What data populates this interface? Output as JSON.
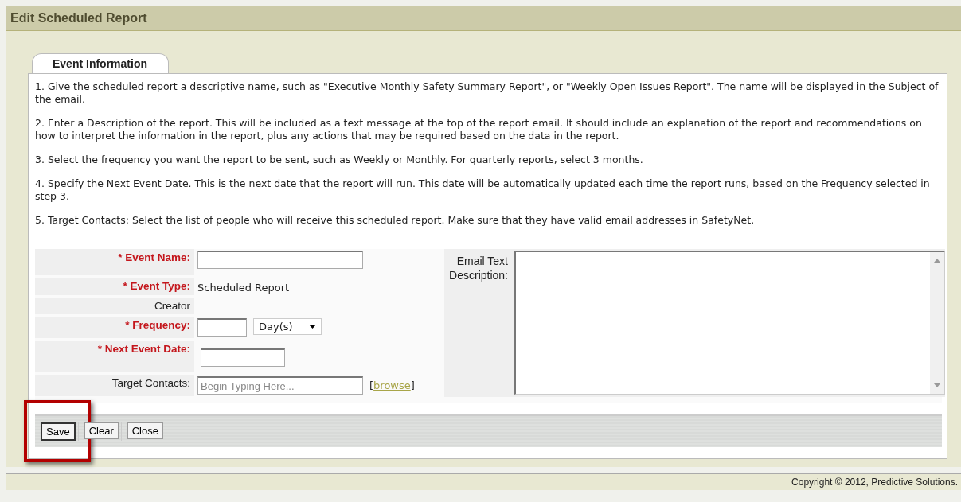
{
  "window": {
    "title": "Edit Scheduled Report"
  },
  "tabs": [
    {
      "label": "Event Information",
      "selected": true
    }
  ],
  "instructions": [
    "1. Give the scheduled report a descriptive name, such as \"Executive Monthly Safety Summary Report\", or \"Weekly Open Issues Report\". The name will be displayed in the Subject of the email.",
    "2. Enter a Description of the report. This will be included as a text message at the top of the report email. It should include an explanation of the report and recommendations on how to interpret the information in the report, plus any actions that may be required based on the data in the report.",
    "3. Select the frequency you want the report to be sent, such as Weekly or Monthly. For quarterly reports, select 3 months.",
    "4. Specify the Next Event Date. This is the next date that the report will run. This date will be automatically updated each time the report runs, based on the Frequency selected in step 3.",
    "5. Target Contacts: Select the list of people who will receive this scheduled report. Make sure that they have valid email addresses in SafetyNet."
  ],
  "fields": [
    {
      "kind": "text",
      "label": "* Event Name:",
      "required": true
    },
    {
      "kind": "static",
      "label": "* Event Type:",
      "required": true,
      "value": "Scheduled Report"
    },
    {
      "kind": "static",
      "label": "Creator",
      "required": false
    },
    {
      "kind": "frequency",
      "label": "* Frequency:",
      "required": true,
      "unit": "Day(s)"
    },
    {
      "kind": "date",
      "label": "* Next Event Date:",
      "required": true
    },
    {
      "kind": "contacts",
      "label": "Target Contacts:",
      "required": false,
      "placeholder": "Begin Typing Here...",
      "link_open": "[",
      "link": "browse",
      "link_close": "]"
    }
  ],
  "description": {
    "label": "Email Text Description:"
  },
  "buttons": [
    {
      "label": "Save",
      "highlighted": true
    },
    {
      "label": "Clear",
      "highlighted": false
    },
    {
      "label": "Close",
      "highlighted": false
    }
  ],
  "footer": "Copyright © 2012, Predictive Solutions."
}
